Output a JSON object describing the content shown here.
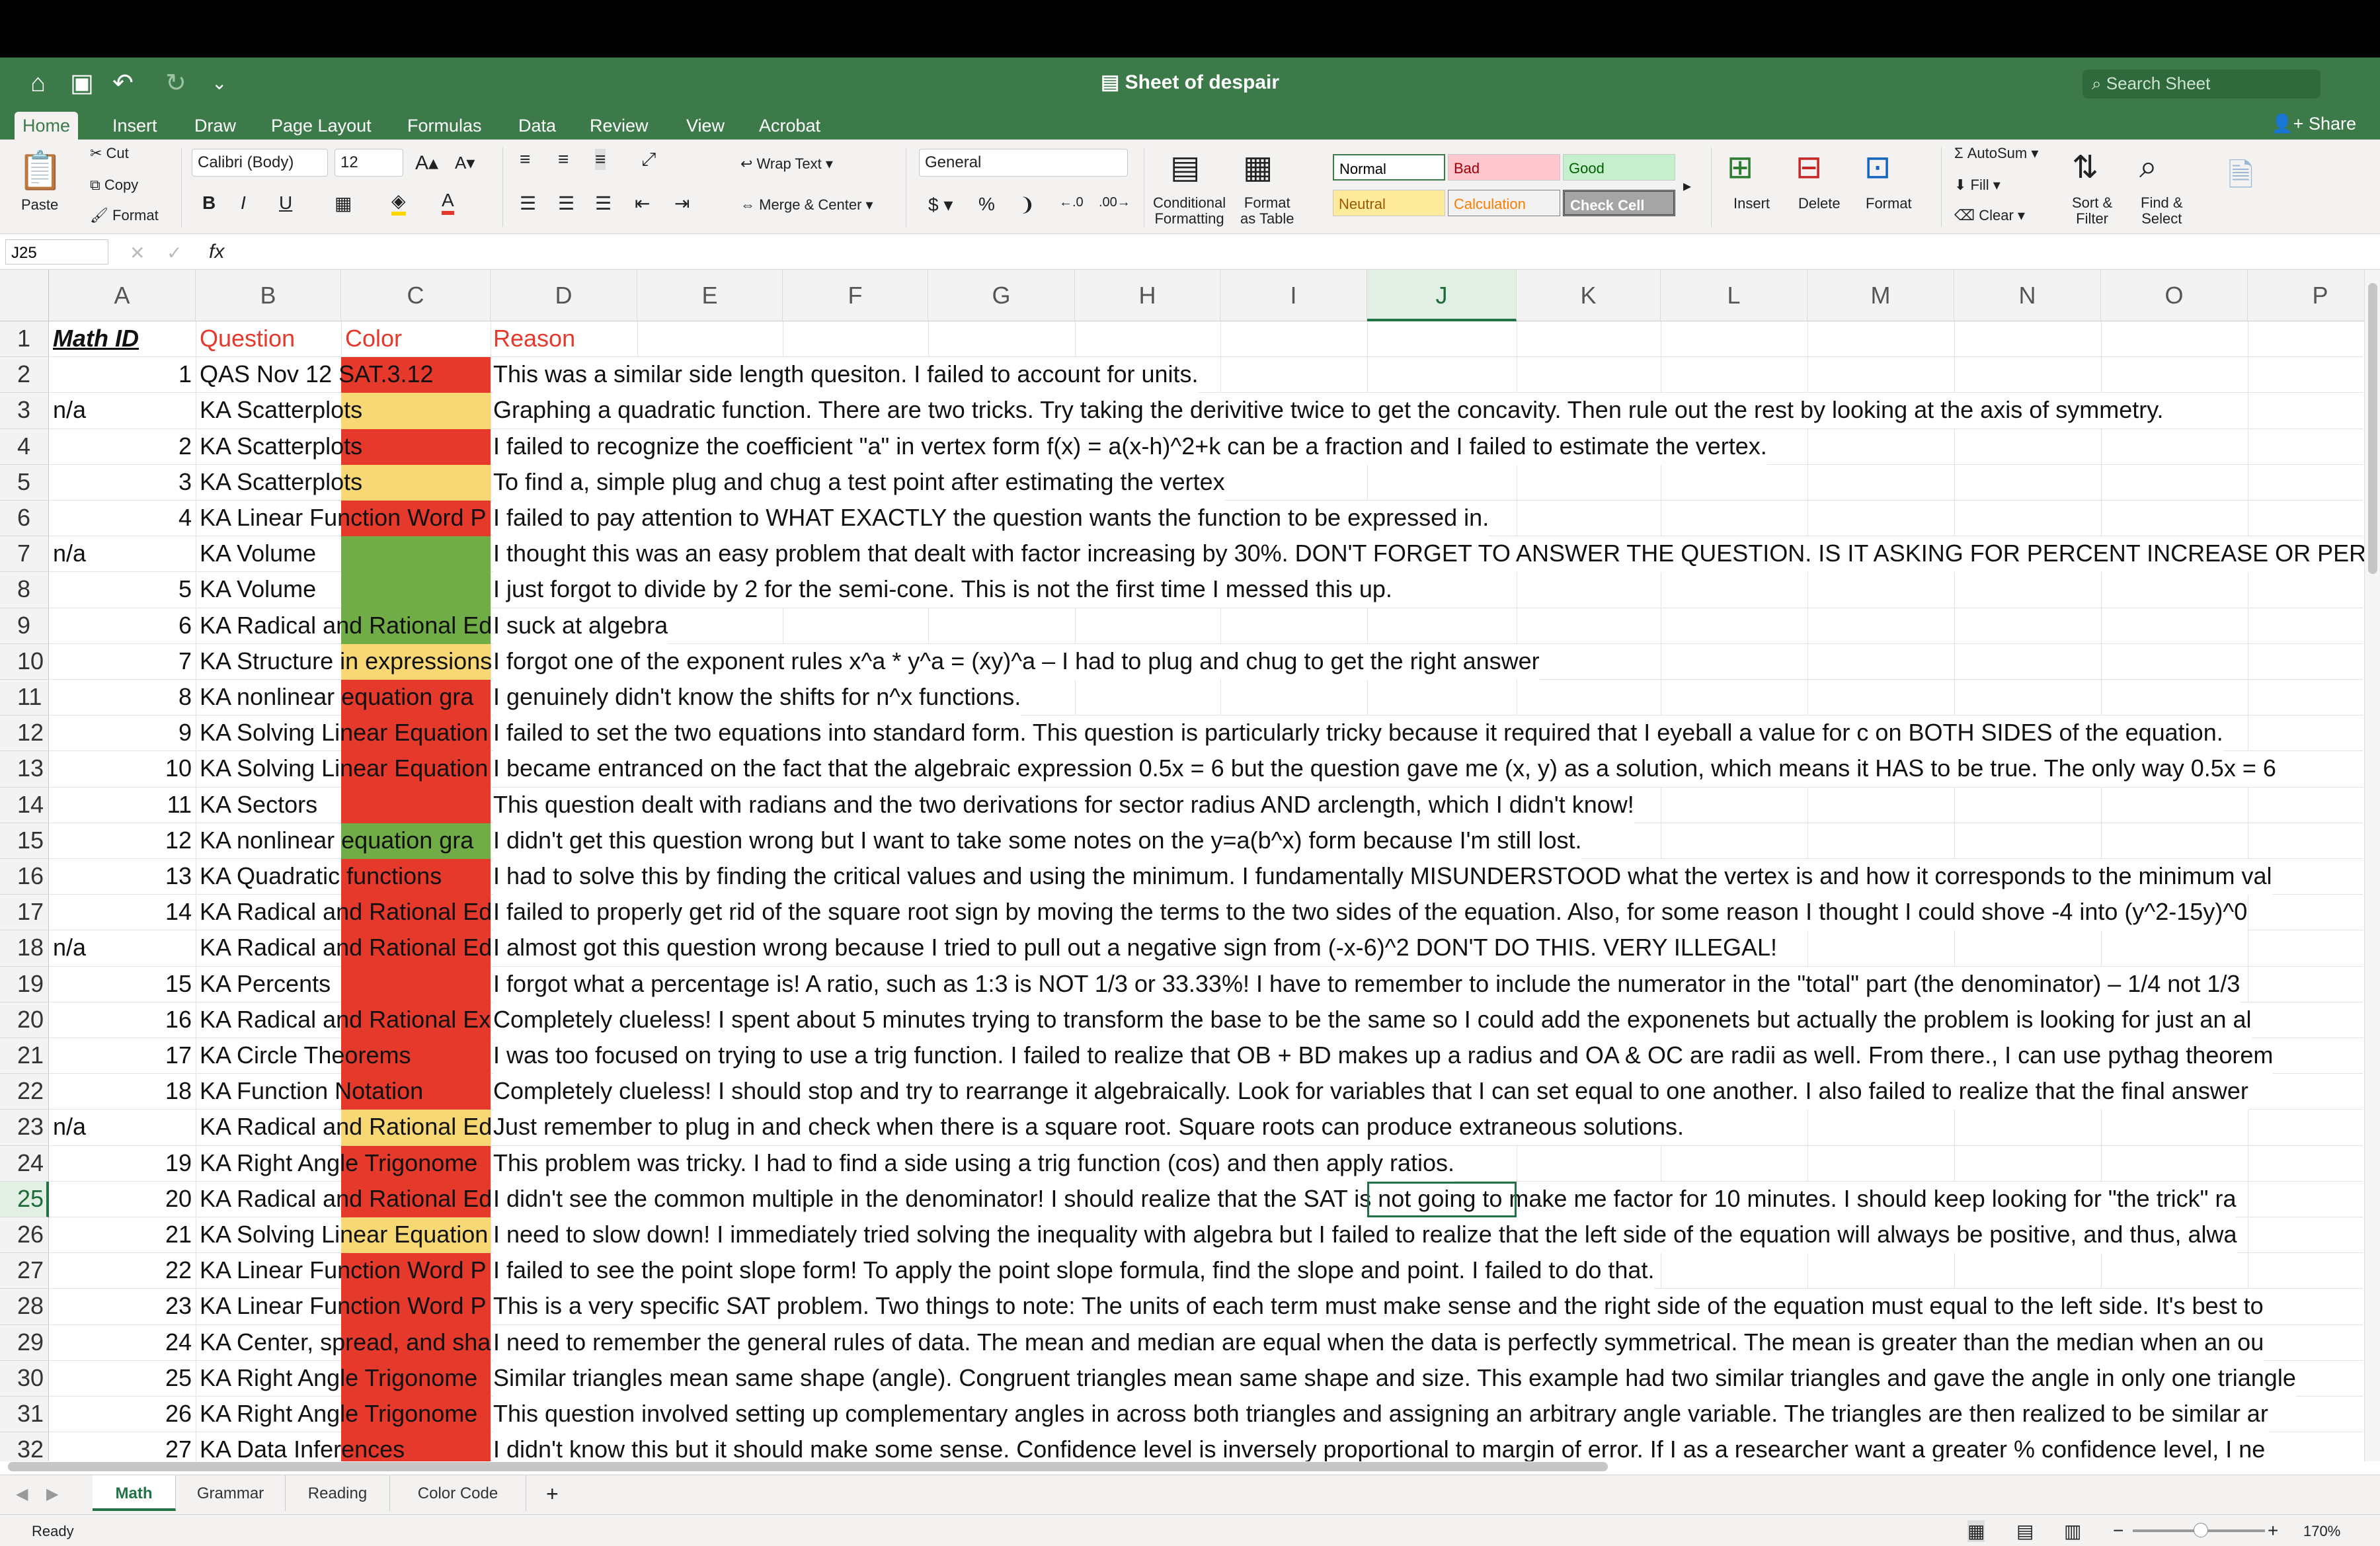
{
  "app": {
    "title": "Sheet of despair",
    "search_placeholder": "Search Sheet",
    "share_label": "Share"
  },
  "menu_tabs": [
    "Home",
    "Insert",
    "Draw",
    "Page Layout",
    "Formulas",
    "Data",
    "Review",
    "View",
    "Acrobat"
  ],
  "ribbon": {
    "paste": "Paste",
    "cut": "Cut",
    "copy": "Copy",
    "format": "Format",
    "font_name": "Calibri (Body)",
    "font_size": "12",
    "wrap_text": "Wrap Text",
    "merge_center": "Merge & Center",
    "number_format": "General",
    "cond_fmt": [
      "Conditional",
      "Formatting"
    ],
    "format_table": [
      "Format",
      "as Table"
    ],
    "styles": [
      "Normal",
      "Bad",
      "Good",
      "Neutral",
      "Calculation",
      "Check Cell"
    ],
    "insert": "Insert",
    "delete": "Delete",
    "format_cells": "Format",
    "autosum": "AutoSum",
    "fill": "Fill",
    "clear": "Clear",
    "sort_filter": [
      "Sort &",
      "Filter"
    ],
    "find_select": [
      "Find &",
      "Select"
    ]
  },
  "formula_bar": {
    "name_box": "J25",
    "fx": "fx",
    "formula": ""
  },
  "colors": {
    "red": "#e5392c",
    "yellow": "#f7d874",
    "green": "#70ad47",
    "ribbon_green": "#3c7a4a"
  },
  "columns": [
    "A",
    "B",
    "C",
    "D",
    "E",
    "F",
    "G",
    "H",
    "I",
    "J",
    "K",
    "L",
    "M",
    "N",
    "O",
    "P"
  ],
  "selected_cell": "J25",
  "rows": [
    {
      "n": "1",
      "a": "Math ID",
      "b": "Question",
      "c": "Color",
      "d": "Reason",
      "color": "none",
      "header": true
    },
    {
      "n": "2",
      "a": "1",
      "b": "QAS Nov 12 SAT.3.12",
      "c": "",
      "d": "This was a similar side length quesiton. I failed to account for units.",
      "color": "red"
    },
    {
      "n": "3",
      "a": "n/a",
      "b": "KA Scatterplots",
      "c": "",
      "d": "Graphing a quadratic function. There are two tricks. Try taking the derivitive twice to get the concavity. Then rule out the rest by looking at the axis of symmetry.",
      "color": "yellow"
    },
    {
      "n": "4",
      "a": "2",
      "b": "KA Scatterplots",
      "c": "",
      "d": "I failed to recognize the coefficient \"a\" in vertex form f(x) = a(x-h)^2+k can be a fraction and I failed to estimate the vertex.",
      "color": "red"
    },
    {
      "n": "5",
      "a": "3",
      "b": "KA Scatterplots",
      "c": "",
      "d": "To find a, simple plug and chug a test point after estimating the vertex",
      "color": "yellow"
    },
    {
      "n": "6",
      "a": "4",
      "b": "KA Linear Function Word P",
      "c": "",
      "d": "I failed to pay attention to WHAT EXACTLY the question wants the function to be expressed in.",
      "color": "red"
    },
    {
      "n": "7",
      "a": "n/a",
      "b": "KA Volume",
      "c": "",
      "d": "I thought this was an easy problem that dealt with factor increasing by 30%. DON'T FORGET TO ANSWER THE QUESTION. IS IT ASKING FOR PERCENT INCREASE OR PERCEN",
      "color": "green"
    },
    {
      "n": "8",
      "a": "5",
      "b": "KA Volume",
      "c": "",
      "d": "I just forgot to divide by 2 for the semi-cone. This is not the first time I messed this up.",
      "color": "green"
    },
    {
      "n": "9",
      "a": "6",
      "b": "KA Radical and Rational Ed",
      "c": "",
      "d": "I suck at algebra",
      "color": "green"
    },
    {
      "n": "10",
      "a": "7",
      "b": "KA Structure in expressions",
      "c": "",
      "d": "I forgot one of the exponent rules x^a * y^a = (xy)^a – I had to plug and chug to get the right answer",
      "color": "yellow"
    },
    {
      "n": "11",
      "a": "8",
      "b": "KA nonlinear equation gra",
      "c": "",
      "d": "I genuinely didn't know the shifts for n^x functions.",
      "color": "red"
    },
    {
      "n": "12",
      "a": "9",
      "b": "KA Solving Linear Equation",
      "c": "",
      "d": "I failed to set the two equations into standard form. This question is particularly tricky because it required that I eyeball a value for c on BOTH SIDES of the equation.",
      "color": "red"
    },
    {
      "n": "13",
      "a": "10",
      "b": "KA Solving Linear Equation",
      "c": "",
      "d": "I became entranced on the fact that the algebraic expression 0.5x = 6 but the question gave me (x, y) as a solution, which means it HAS to be true. The only way 0.5x = 6",
      "color": "red"
    },
    {
      "n": "14",
      "a": "11",
      "b": "KA Sectors",
      "c": "",
      "d": "This question dealt with radians and the two derivations for sector radius AND arclength, which I didn't know!",
      "color": "red"
    },
    {
      "n": "15",
      "a": "12",
      "b": "KA nonlinear equation gra",
      "c": "",
      "d": "I didn't get this question wrong but I want to take some notes on the y=a(b^x) form because I'm still lost.",
      "color": "green"
    },
    {
      "n": "16",
      "a": "13",
      "b": "KA Quadratic functions",
      "c": "",
      "d": "I had to solve this by finding the critical values and using the minimum. I fundamentally MISUNDERSTOOD what the vertex is and how it corresponds to the minimum val",
      "color": "red"
    },
    {
      "n": "17",
      "a": "14",
      "b": "KA Radical and Rational Ed",
      "c": "",
      "d": "I failed to properly get rid of the square root sign by moving the terms to the two sides of the equation. Also, for some reason I thought I could shove -4 into (y^2-15y)^0",
      "color": "red"
    },
    {
      "n": "18",
      "a": "n/a",
      "b": "KA Radical and Rational Ed",
      "c": "",
      "d": "I almost got this question wrong because I tried to pull out a negative sign from (-x-6)^2 DON'T DO THIS. VERY ILLEGAL!",
      "color": "red"
    },
    {
      "n": "19",
      "a": "15",
      "b": "KA Percents",
      "c": "",
      "d": "I forgot what a percentage is! A ratio, such as 1:3 is NOT 1/3 or 33.33%! I have to remember to include the numerator in the \"total\" part (the denominator) – 1/4 not 1/3",
      "color": "red"
    },
    {
      "n": "20",
      "a": "16",
      "b": "KA Radical and Rational Ex",
      "c": "",
      "d": "Completely clueless! I spent about 5 minutes trying to transform the base to be the same so I could add the exponenets but actually the problem is looking for just an al",
      "color": "red"
    },
    {
      "n": "21",
      "a": "17",
      "b": "KA Circle Theorems",
      "c": "",
      "d": "I was too focused on trying to use a trig function. I failed to realize that OB + BD makes up a radius and OA & OC are radii as well. From there., I can use pythag theorem",
      "color": "red"
    },
    {
      "n": "22",
      "a": "18",
      "b": "KA Function Notation",
      "c": "",
      "d": "Completely clueless! I should stop and try to rearrange it algebraically. Look for variables that I can set equal to one another. I also failed to realize that the final answer",
      "color": "red"
    },
    {
      "n": "23",
      "a": "n/a",
      "b": "KA Radical and Rational Ed",
      "c": "",
      "d": "Just remember to plug in and check when there is a square root. Square roots can produce extraneous solutions.",
      "color": "yellow"
    },
    {
      "n": "24",
      "a": "19",
      "b": "KA Right Angle Trigonome",
      "c": "",
      "d": "This problem was tricky. I had to find a side using a trig function (cos) and then apply ratios.",
      "color": "red"
    },
    {
      "n": "25",
      "a": "20",
      "b": "KA Radical and Rational Ed",
      "c": "",
      "d": "I didn't see the common multiple in the denominator! I should realize that the SAT is not going to make me factor for 10 minutes. I should keep looking for \"the trick\" ra",
      "color": "red"
    },
    {
      "n": "26",
      "a": "21",
      "b": "KA Solving Linear Equation",
      "c": "",
      "d": "I need to slow down! I immediately tried solving the inequality with algebra but I failed to realize that the left side of the equation will always be positive, and thus, alwa",
      "color": "yellow"
    },
    {
      "n": "27",
      "a": "22",
      "b": "KA Linear Function Word P",
      "c": "",
      "d": "I failed to see the point slope form! To apply the point slope formula, find the slope and point. I failed to do that.",
      "color": "red"
    },
    {
      "n": "28",
      "a": "23",
      "b": "KA Linear Function Word P",
      "c": "",
      "d": "This is a very specific SAT problem. Two things to note: The units of each term must make sense and the right side of the equation must equal to the left side. It's best to",
      "color": "red"
    },
    {
      "n": "29",
      "a": "24",
      "b": "KA Center, spread, and sha",
      "c": "",
      "d": "I need to remember the general rules of data. The mean and median are equal when the data is perfectly symmetrical. The mean is greater than the median when an ou",
      "color": "red"
    },
    {
      "n": "30",
      "a": "25",
      "b": "KA Right Angle Trigonome",
      "c": "",
      "d": "Similar triangles mean same shape (angle). Congruent triangles mean same shape and size. This example had two similar triangles and gave the angle in only one triangle",
      "color": "red"
    },
    {
      "n": "31",
      "a": "26",
      "b": "KA Right Angle Trigonome",
      "c": "",
      "d": "This question involved setting up complementary angles in across both triangles and assigning an arbitrary angle variable. The triangles are then realized to be similar ar",
      "color": "red"
    },
    {
      "n": "32",
      "a": "27",
      "b": "KA Data Inferences",
      "c": "",
      "d": "I didn't know this but it should make some sense. Confidence level is inversely proportional to margin of error. If I as a researcher want a greater % confidence level, I ne",
      "color": "red"
    }
  ],
  "sheet_tabs": [
    "Math",
    "Grammar",
    "Reading",
    "Color Code"
  ],
  "active_sheet": "Math",
  "status": {
    "ready": "Ready",
    "zoom": "170%"
  }
}
